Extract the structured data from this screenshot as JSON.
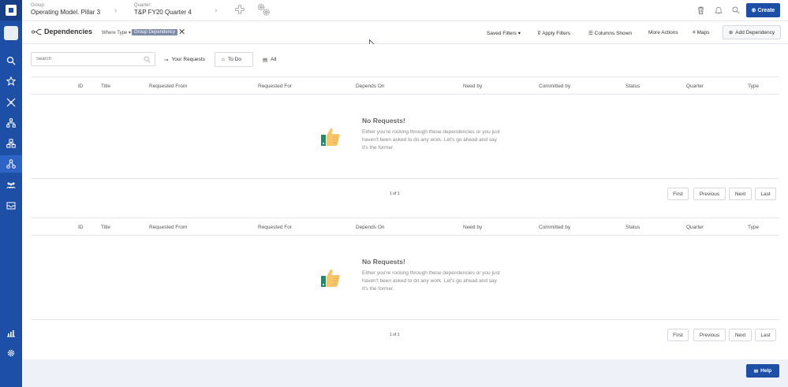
{
  "topbar": {
    "group_label": "Group:",
    "group_value": "Operating Model. Pillar 3",
    "quarter_label": "Quarter:",
    "quarter_value": "T&P FY20 Quarter 4",
    "create_label": "Create"
  },
  "toolbar": {
    "title": "Dependencies",
    "where_type": "Where Type",
    "chip": "Group Dependency",
    "saved_filters": "Saved Filters",
    "apply_filters": "Apply Filters",
    "columns_shown": "Columns Shown",
    "more_actions": "More Actions",
    "maps": "Maps",
    "add_dependency": "Add Dependency"
  },
  "filters": {
    "search_placeholder": "Search",
    "your_requests": "Your Requests",
    "to_do": "To Do",
    "all": "All"
  },
  "columns": [
    "ID",
    "Title",
    "Requested From",
    "Requested For",
    "Depends On",
    "Need by",
    "Committed by",
    "Status",
    "Quarter",
    "Type"
  ],
  "tables": [
    {
      "empty_title": "No Requests!",
      "empty_message": "Either you're rocking through these dependencies or you just haven't been asked to do any work. Let's go ahead and say it's the former.",
      "page_info": "1 of 1",
      "first": "First",
      "previous": "Previous",
      "next": "Next",
      "last": "Last"
    },
    {
      "empty_title": "No Requests!",
      "empty_message": "Either you're rocking through these dependencies or you just haven't been asked to do any work. Let's go ahead and say it's the former.",
      "page_info": "1 of 1",
      "first": "First",
      "previous": "Previous",
      "next": "Next",
      "last": "Last"
    }
  ],
  "help_label": "Help",
  "colors": {
    "brand": "#1e4fa6",
    "rail_active": "#2d63c4",
    "chip": "#7b8aa6"
  },
  "icons": [
    "search-icon",
    "star-icon",
    "chart-icon",
    "hierarchy-icon",
    "org-icon",
    "dependency-icon",
    "team-icon",
    "inbox-icon",
    "reports-icon",
    "settings-icon",
    "bell-icon",
    "trash-icon",
    "thumbs-up-icon"
  ]
}
